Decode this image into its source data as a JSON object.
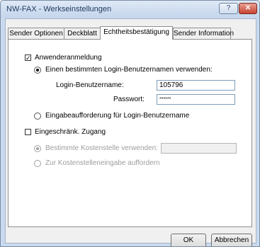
{
  "window": {
    "title": "NW-FAX - Werkseinstellungen",
    "help_glyph": "?",
    "close_glyph": "✕"
  },
  "tabs": [
    "Sender Optionen",
    "Deckblatt",
    "Echtheitsbestätigung",
    "Sender Information"
  ],
  "active_tab": "Echtheitsbestätigung",
  "auth": {
    "user_login_label": "Anwenderanmeldung",
    "user_login_checked": true,
    "specific_login_label": "Einen bestimmten Login-Benutzernamen verwenden:",
    "login_name_label": "Login-Benutzername:",
    "login_name_value": "105796",
    "password_label": "Passwort:",
    "password_value": "******",
    "prompt_login_label": "Eingabeaufforderung für Login-Benutzername",
    "restricted_label": "Eingeschränk. Zugang",
    "restricted_checked": false,
    "cost_center_label": "Bestimmte Kostenstelle verwenden:",
    "cost_center_value": "",
    "cost_prompt_label": "Zur Kostenstelleneingabe auffordern"
  },
  "buttons": {
    "ok": "OK",
    "cancel": "Abbrechen"
  }
}
